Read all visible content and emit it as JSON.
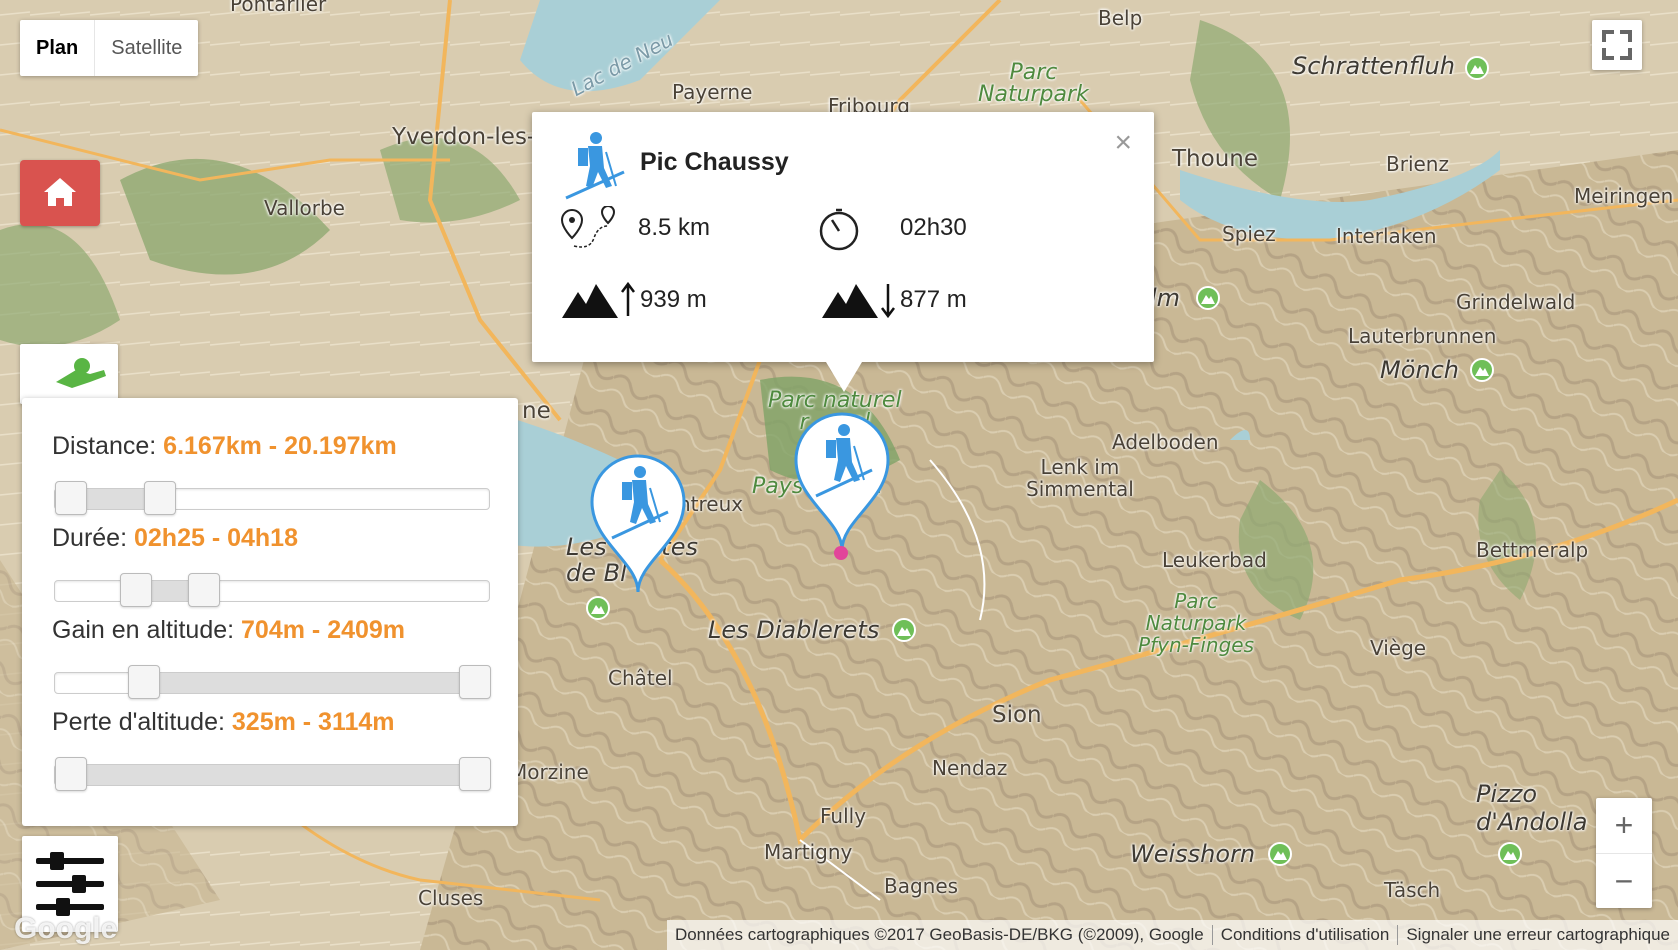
{
  "map_type": {
    "plan": "Plan",
    "satellite": "Satellite",
    "active": "Plan"
  },
  "places": {
    "pontarlier": "Pontarlier",
    "belp": "Belp",
    "lac_neuchatel": "Lac de Neu",
    "payerne": "Payerne",
    "fribourg": "Fribourg",
    "yverdon": "Yverdon-les-",
    "vallorbe": "Vallorbe",
    "thoune": "Thoune",
    "brienz": "Brienz",
    "meiringen": "Meiringen",
    "spiez": "Spiez",
    "interlaken": "Interlaken",
    "grindelwald": "Grindelwald",
    "lauterbrunnen": "Lauterbrunnen",
    "adelboden": "Adelboden",
    "lenk": "Lenk im\nSimmental",
    "leukerbad": "Leukerbad",
    "bettmeralp": "Bettmeralp",
    "montreux": "ntreux",
    "lausanne": "ne",
    "chatel": "Châtel",
    "sion": "Sion",
    "viege": "Viège",
    "nendaz": "Nendaz",
    "morzine": "Morzine",
    "fully": "Fully",
    "martigny": "Martigny",
    "bagnes": "Bagnes",
    "tasch": "Täsch",
    "cluses": "Cluses",
    "pleiades": "Les  nettes\nde Bl",
    "diablerets": "Les Diablerets",
    "schrattenfluh": "Schrattenfluh",
    "monch": "Mönch",
    "weisshorn": "Weisshorn",
    "pizzo": "Pizzo\nd'Andolla",
    "lm": "lm",
    "park1": "Parc\nNaturpark",
    "park2": "Parc naturel\nr    nal",
    "park3": "Pays    haut",
    "park4": "Parc\nNaturpark\nPfyn-Finges"
  },
  "popup": {
    "title": "Pic Chaussy",
    "distance": "8.5 km",
    "duration": "02h30",
    "ascent": "939 m",
    "descent": "877 m",
    "close": "×"
  },
  "filters": {
    "distance": {
      "label": "Distance:",
      "value": "6.167km - 20.197km",
      "low": 0.0,
      "high": 0.22
    },
    "duration": {
      "label": "Durée:",
      "value": "02h25 - 04h18",
      "low": 0.16,
      "high": 0.33
    },
    "gain": {
      "label": "Gain en altitude:",
      "value": "704m - 2409m",
      "low": 0.18,
      "high": 1.0
    },
    "loss": {
      "label": "Perte d'altitude:",
      "value": "325m - 3114m",
      "low": 0.0,
      "high": 1.0
    }
  },
  "zoom": {
    "in": "+",
    "out": "−"
  },
  "attribution": {
    "data": "Données cartographiques ©2017 GeoBasis-DE/BKG (©2009), Google",
    "terms": "Conditions d'utilisation",
    "report": "Signaler une erreur cartographique"
  },
  "google": "Google",
  "colors": {
    "accent": "#f0922e",
    "marker": "#3a97e0",
    "home": "#d9534f",
    "park_green": "#6fbf58"
  }
}
